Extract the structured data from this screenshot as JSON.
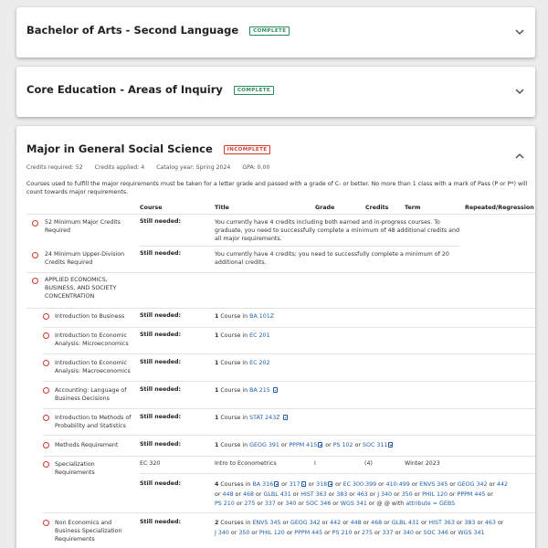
{
  "sections": [
    {
      "title": "Bachelor of Arts - Second Language",
      "status": "COMPLETE"
    },
    {
      "title": "Core Education - Areas of Inquiry",
      "status": "COMPLETE"
    },
    {
      "title": "Major in General Social Science",
      "status": "INCOMPLETE"
    }
  ],
  "major": {
    "credits_required": "Credits required:  52",
    "credits_applied": "Credits applied:  4",
    "catalog_year": "Catalog year:  Spring 2024",
    "gpa": "GPA:  0.00",
    "note": "Courses used to fulfill the major requirements must be taken for a letter grade and passed with a grade of C- or better. No more than 1 class with a mark of Pass (P or P*) will count towards major requirements.",
    "columns": [
      "Course",
      "Title",
      "Grade",
      "Credits",
      "Term",
      "Repeated/Regression"
    ],
    "still_needed": "Still needed:",
    "requirements": [
      {
        "name": "52 Minimum Major Credits Required",
        "desc": "You currently have 4 credits including both earned and in-progress courses. To graduate, you need to successfully complete a minimum of 48 additional credits and all major requirements."
      },
      {
        "name": "24 Minimum Upper-Division Credits Required",
        "desc": "You currently have 4 credits; you need to successfully complete a minimum of 20 additional credits."
      },
      {
        "name": "APPLIED ECONOMICS, BUSINESS, AND SOCIETY CONCENTRATION"
      },
      {
        "name": "Introduction to Business",
        "count": "1",
        "course_word": "Course in",
        "course": "BA 101Z"
      },
      {
        "name": "Introduction to Economic Analysis: Microeconomics",
        "count": "1",
        "course_word": "Course in",
        "course": "EC 201"
      },
      {
        "name": "Introduction to Economic Analysis: Macroeconomics",
        "count": "1",
        "course_word": "Course in",
        "course": "EC 202"
      },
      {
        "name": "Accounting: Language of Business Decisions",
        "count": "1",
        "course_word": "Course in",
        "course": "BA 215"
      },
      {
        "name": "Introduction to Methods of Probability and Statistics",
        "count": "1",
        "course_word": "Course in",
        "course": "STAT 243Z"
      },
      {
        "name": "Methods Requirement",
        "count": "1",
        "course_word": "Course in",
        "course": "GEOG 391",
        "or1": "or",
        "c2": "PPPM 415",
        "or2": "or",
        "c3": "PS 102",
        "or3": "or",
        "c4": "SOC 311"
      },
      {
        "name": "Specialization Requirements",
        "taken": {
          "course": "EC 320",
          "title": "Intro to Econometrics",
          "grade": "I",
          "credits": "(4)",
          "term": "Winter 2023"
        },
        "line1": {
          "count": "4",
          "word": "Courses in",
          "a": "BA 316",
          "b": "317",
          "c": "318",
          "d": "EC 300:399",
          "e": "410:499",
          "f": "ENVS 345",
          "g": "GEOG 342",
          "h": "442"
        },
        "line2": {
          "a": "448",
          "b": "468",
          "c": "GLBL 431",
          "d": "HIST 363",
          "e": "383",
          "f": "463",
          "g": "J 340",
          "h": "350",
          "i": "PHIL 120",
          "j": "PPPM 445"
        },
        "line3": {
          "a": "PS 210",
          "b": "275",
          "c": "337",
          "d": "340",
          "e": "SOC 346",
          "f": "WGS 341",
          "g": "@ @ with",
          "h": "attribute = GEBS"
        }
      },
      {
        "name": "Non Economics and Business Specialization Requirements",
        "line1": {
          "count": "2",
          "word": "Courses in",
          "a": "ENVS 345",
          "b": "GEOG 342",
          "c": "442",
          "d": "448",
          "e": "468",
          "f": "GLBL 431",
          "g": "HIST 363",
          "h": "383",
          "i": "463"
        },
        "line2": {
          "a": "J 340",
          "b": "350",
          "c": "PHIL 120",
          "d": "PPPM 445",
          "e": "PS 210",
          "f": "275",
          "g": "337",
          "h": "340",
          "i": "SOC 346",
          "j": "WGS 341"
        }
      }
    ]
  },
  "or": "or",
  "colors": {
    "complete": "#2a8a5a",
    "incomplete": "#d33a2a",
    "link": "#1f5fae"
  }
}
